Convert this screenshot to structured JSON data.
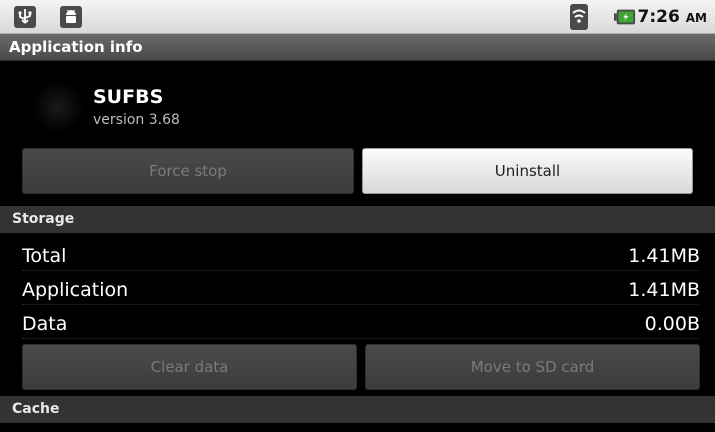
{
  "status_bar": {
    "time": "7:26",
    "ampm": "AM",
    "icons": [
      "usb-icon",
      "android-icon",
      "wifi-icon",
      "battery-icon"
    ]
  },
  "title_bar": {
    "title": "Application info"
  },
  "app": {
    "name": "SUFBS",
    "version": "version 3.68"
  },
  "buttons": {
    "force_stop": "Force stop",
    "uninstall": "Uninstall",
    "clear_data": "Clear data",
    "move_to_sd": "Move to SD card"
  },
  "storage": {
    "header": "Storage",
    "rows": [
      {
        "label": "Total",
        "value": "1.41MB"
      },
      {
        "label": "Application",
        "value": "1.41MB"
      },
      {
        "label": "Data",
        "value": "0.00B"
      }
    ]
  },
  "cache": {
    "header": "Cache"
  },
  "colors": {
    "accent_red": "#c0141c",
    "battery_green": "#3fa535"
  }
}
